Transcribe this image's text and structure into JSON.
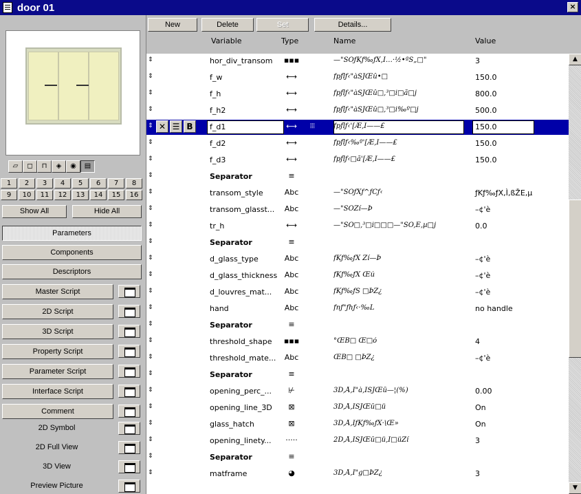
{
  "window": {
    "title": "door 01",
    "close_glyph": "×"
  },
  "left": {
    "view_buttons": [
      "▱",
      "◻",
      "⊓",
      "◈",
      "◉",
      "▤"
    ],
    "nums_row1": [
      "1",
      "2",
      "3",
      "4",
      "5",
      "6",
      "7",
      "8"
    ],
    "nums_row2": [
      "9",
      "10",
      "11",
      "12",
      "13",
      "14",
      "15",
      "16"
    ],
    "show_all": "Show All",
    "hide_all": "Hide All",
    "sections": [
      "Parameters",
      "Components",
      "Descriptors"
    ],
    "scripts": [
      "Master Script",
      "2D Script",
      "3D Script",
      "Property Script",
      "Parameter Script",
      "Interface Script",
      "Comment"
    ],
    "views": [
      "2D Symbol",
      "2D Full View",
      "3D View",
      "Preview Picture"
    ]
  },
  "toolbar": {
    "new": "New",
    "delete": "Delete",
    "set": "Set",
    "details": "Details..."
  },
  "columns": {
    "variable": "Variable",
    "type": "Type",
    "name": "Name",
    "value": "Value"
  },
  "rows": [
    {
      "var": "hor_div_transom",
      "type": "▪▪▪",
      "name": "—\"ŠÔƒKƒ‰ƒX,Ì…·½•ªŠ„□\"",
      "value": "3"
    },
    {
      "var": "f_w",
      "type": "⟷",
      "name": "ƒpƒlƒ‹\"àŠJŒû•□",
      "value": "150.0"
    },
    {
      "var": "f_h",
      "type": "⟷",
      "name": "ƒpƒlƒ‹\"àŠJŒû□,³□i□ã□j",
      "value": "800.0"
    },
    {
      "var": "f_h2",
      "type": "⟷",
      "name": "ƒpƒlƒ‹\"àŠJŒû□,³□i‰º□j",
      "value": "500.0"
    },
    {
      "var": "f_d1",
      "type": "⟷",
      "name": "ƒpƒlƒ‹'[Æ,Ì——£",
      "value": "150.0"
    },
    {
      "var": "f_d2",
      "type": "⟷",
      "name": "ƒpƒlƒ‹‰º'[Æ,Ì——£",
      "value": "150.0"
    },
    {
      "var": "f_d3",
      "type": "⟷",
      "name": "ƒpƒlƒ‹□ã'[Æ,Ì——£",
      "value": "150.0"
    },
    {
      "var": "Separator",
      "type": "≡",
      "name": "",
      "value": ""
    },
    {
      "var": "transom_style",
      "type": "Abc",
      "name": "—\"ŠÔƒXƒ^ƒCƒ‹",
      "value": "ƒKƒ‰ƒX,Ì,ßŽE,µ"
    },
    {
      "var": "transom_glasst...",
      "type": "Abc",
      "name": "—\"ŠÔŽí—Þ",
      "value": "–¢'è"
    },
    {
      "var": "tr_h",
      "type": "⟷",
      "name": "—\"ŠÔ□,³□i□□□—\"ŠÔ,È,µ□j",
      "value": "0.0"
    },
    {
      "var": "Separator",
      "type": "≡",
      "name": "",
      "value": ""
    },
    {
      "var": "d_glass_type",
      "type": "Abc",
      "name": "ƒKƒ‰ƒX Ží—Þ",
      "value": "–¢'è"
    },
    {
      "var": "d_glass_thickness",
      "type": "Abc",
      "name": "ƒKƒ‰ƒX Œú",
      "value": "–¢'è"
    },
    {
      "var": "d_louvres_mat...",
      "type": "Abc",
      "name": "ƒKƒ‰ƒŠ □ÞŽ¿",
      "value": "–¢'è"
    },
    {
      "var": "hand",
      "type": "Abc",
      "name": "ƒnƒ\"ƒhƒ‹·‰L",
      "value": "no handle"
    },
    {
      "var": "Separator",
      "type": "≡",
      "name": "",
      "value": ""
    },
    {
      "var": "threshold_shape",
      "type": "▪▪▪",
      "name": "°ŒB□ Œ□ó",
      "value": "4"
    },
    {
      "var": "threshold_mate...",
      "type": "Abc",
      "name": "ŒB□ □ÞŽ¿",
      "value": "–¢'è"
    },
    {
      "var": "Separator",
      "type": "≡",
      "name": "",
      "value": ""
    },
    {
      "var": "opening_perc_...",
      "type": "⊬",
      "name": "3D,Å,Ì\"à,ÌŠJŒû—¦(%)",
      "value": "0.00"
    },
    {
      "var": "opening_line_3D",
      "type": "⊠",
      "name": "3D,Å,ÌŠJŒû□ü",
      "value": "On"
    },
    {
      "var": "glass_hatch",
      "type": "⊠",
      "name": "3D,Å,ÌƒKƒ‰ƒX·\\Œ»",
      "value": "On"
    },
    {
      "var": "opening_linety...",
      "type": "·····",
      "name": "2D,Å,ÌŠJŒû□ü,Ì□üŽí",
      "value": "3"
    },
    {
      "var": "Separator",
      "type": "≡",
      "name": "",
      "value": ""
    },
    {
      "var": "matframe",
      "type": "◕",
      "name": "3D,Å,Ì\"g□ÞŽ¿",
      "value": "3"
    }
  ]
}
